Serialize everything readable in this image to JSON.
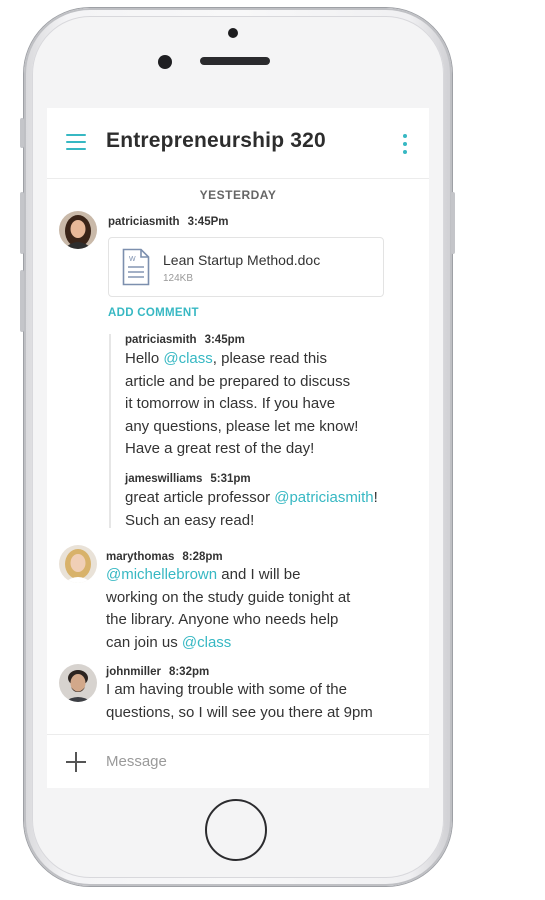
{
  "header": {
    "title": "Entrepreneurship 320",
    "menu_icon": "hamburger-menu-icon",
    "more_icon": "vertical-dots-icon"
  },
  "day_divider": "YESTERDAY",
  "post": {
    "author": "patriciasmith",
    "time": "3:45Pm",
    "attachment": {
      "name": "Lean Startup Method.doc",
      "size": "124KB",
      "icon": "word-document-icon"
    },
    "add_comment": "ADD COMMENT",
    "comments": [
      {
        "author": "patriciasmith",
        "time": "3:45pm",
        "text_before": "Hello ",
        "mention": "@class",
        "text_after": ", please read this\narticle and be prepared to discuss\nit tomorrow in class. If you have\nany questions, please let me know!\nHave a great rest of the day!"
      },
      {
        "author": "jameswilliams",
        "time": "5:31pm",
        "text_before": "great article professor ",
        "mention": "@patriciasmith",
        "text_after": "!\nSuch an easy read!"
      }
    ]
  },
  "messages": [
    {
      "author": "marythomas",
      "time": "8:28pm",
      "mention1": "@michellebrown",
      "text": " and I will be\nworking on the study guide tonight at\nthe library. Anyone who needs help\ncan join us ",
      "mention2": "@class"
    },
    {
      "author": "johnmiller",
      "time": "8:32pm",
      "text": "I am having trouble with some of the\nquestions, so I will see you there at 9pm"
    }
  ],
  "composer": {
    "placeholder": "Message",
    "plus_icon": "plus-icon"
  },
  "colors": {
    "accent": "#37b8c3",
    "text": "#333333"
  }
}
